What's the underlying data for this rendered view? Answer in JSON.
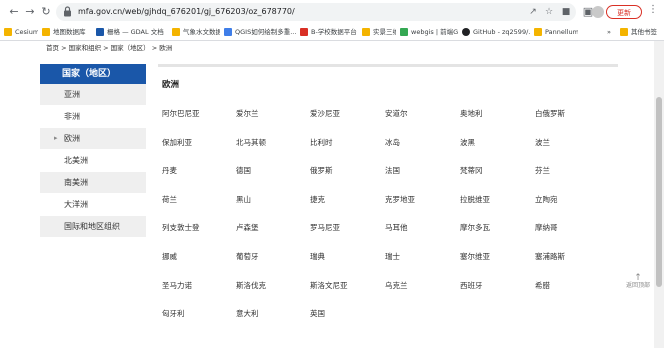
{
  "browser": {
    "url": "mfa.gov.cn/web/gjhdq_676201/gj_676203/oz_678770/",
    "update_label": "更新",
    "bookmarks": [
      {
        "label": "Cesium",
        "color": "#f4b400"
      },
      {
        "label": "地图数据库",
        "color": "#f4b400"
      },
      {
        "label": "栅格 — GDAL 文档",
        "color": "#1a57a9"
      },
      {
        "label": "气象水文数据",
        "color": "#f4b400"
      },
      {
        "label": "QGIS如何绘制多重...",
        "color": "#3f7ee8"
      },
      {
        "label": "B-学校数据平台",
        "color": "#d93025"
      },
      {
        "label": "实景三维",
        "color": "#f4b400"
      },
      {
        "label": "webgis | 前端GIS",
        "color": "#34a853"
      },
      {
        "label": "GitHub - zq2599/...",
        "color": "#202124"
      },
      {
        "label": "Pannellum",
        "color": "#f4b400"
      },
      {
        "label": "其他书签",
        "color": "#f4b400"
      }
    ],
    "overflow_label": "»"
  },
  "breadcrumb": "首页 > 国家和组织 > 国家（地区） > 欧洲",
  "sidebar": {
    "header": "国家（地区）",
    "items": [
      {
        "label": "亚洲"
      },
      {
        "label": "非洲"
      },
      {
        "label": "欧洲"
      },
      {
        "label": "北美洲"
      },
      {
        "label": "南美洲"
      },
      {
        "label": "大洋洲"
      },
      {
        "label": "国际和地区组织"
      }
    ]
  },
  "content": {
    "title": "欧洲",
    "countries": [
      "阿尔巴尼亚",
      "爱尔兰",
      "爱沙尼亚",
      "安道尔",
      "奥地利",
      "白俄罗斯",
      "保加利亚",
      "北马其顿",
      "比利时",
      "冰岛",
      "波黑",
      "波兰",
      "丹麦",
      "德国",
      "俄罗斯",
      "法国",
      "梵蒂冈",
      "芬兰",
      "荷兰",
      "黑山",
      "捷克",
      "克罗地亚",
      "拉脱维亚",
      "立陶宛",
      "列支敦士登",
      "卢森堡",
      "罗马尼亚",
      "马耳他",
      "摩尔多瓦",
      "摩纳哥",
      "挪威",
      "葡萄牙",
      "瑞典",
      "瑞士",
      "塞尔维亚",
      "塞浦路斯",
      "圣马力诺",
      "斯洛伐克",
      "斯洛文尼亚",
      "乌克兰",
      "西班牙",
      "希腊",
      "匈牙利",
      "意大利",
      "英国"
    ]
  },
  "back_to_top": "返回顶部"
}
